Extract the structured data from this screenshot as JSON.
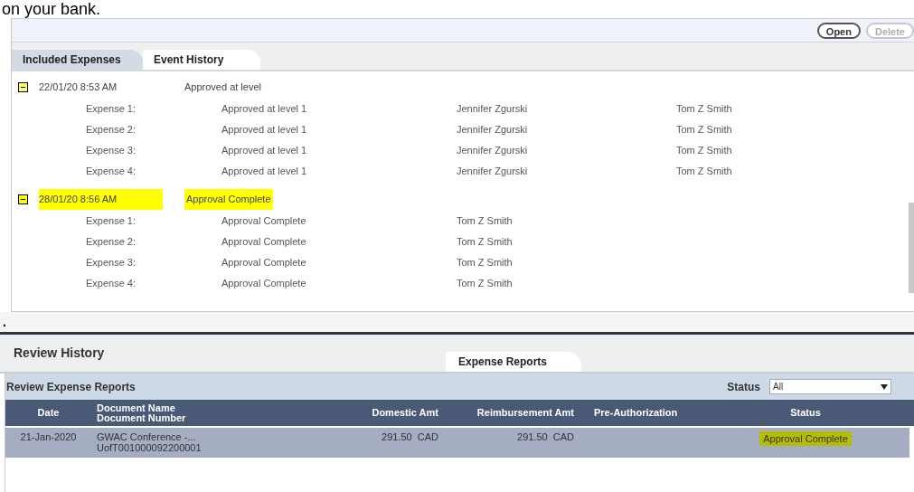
{
  "page_text": "on your bank.",
  "toolbar": {
    "buttons": [
      {
        "label": "Open",
        "disabled": false
      },
      {
        "label": "Delete",
        "disabled": true
      }
    ]
  },
  "tabs": [
    {
      "label": "Included Expenses",
      "selected": false
    },
    {
      "label": "Event History",
      "selected": true
    }
  ],
  "event_groups": [
    {
      "time": "22/01/20 8:53 AM",
      "event": "Approved at level",
      "expanded": true,
      "highlighted": false,
      "children": [
        {
          "item": "Expense 1:",
          "status": "Approved at level 1",
          "approver": "Jennifer Zgurski",
          "submitter": "Tom Z Smith"
        },
        {
          "item": "Expense 2:",
          "status": "Approved at level 1",
          "approver": "Jennifer Zgurski",
          "submitter": "Tom Z Smith"
        },
        {
          "item": "Expense 3:",
          "status": "Approved at level 1",
          "approver": "Jennifer Zgurski",
          "submitter": "Tom Z Smith"
        },
        {
          "item": "Expense 4:",
          "status": "Approved at level 1",
          "approver": "Jennifer Zgurski",
          "submitter": "Tom Z Smith"
        }
      ]
    },
    {
      "time": "28/01/20 8:56 AM",
      "event": "Approval Complete",
      "expanded": true,
      "highlighted": true,
      "children": [
        {
          "item": "Expense 1:",
          "status": "Approval Complete",
          "approver": "Tom Z Smith"
        },
        {
          "item": "Expense 2:",
          "status": "Approval Complete",
          "approver": "Tom Z Smith"
        },
        {
          "item": "Expense 3:",
          "status": "Approval Complete",
          "approver": "Tom Z Smith"
        },
        {
          "item": "Expense 4:",
          "status": "Approval Complete",
          "approver": "Tom Z Smith"
        }
      ]
    }
  ],
  "stray_mark": ".",
  "review": {
    "title": "Review History",
    "tabs": [
      {
        "label": "Expense Reports",
        "selected": true
      }
    ],
    "subtitle": "Review Expense Reports",
    "filter": {
      "label": "Status",
      "value": "All"
    },
    "columns": [
      {
        "lines": [
          "Date"
        ]
      },
      {
        "lines": [
          "Document Name",
          "Document Number"
        ]
      },
      {
        "lines": [
          "Domestic Amt"
        ]
      },
      {
        "lines": [
          "Reimbursement Amt"
        ]
      },
      {
        "lines": [
          "Pre-Authorization"
        ]
      },
      {
        "lines": [
          "Status"
        ]
      }
    ],
    "rows": [
      {
        "date": "21-Jan-2020",
        "document_name": "GWAC Conference -...",
        "document_number": "UofT001000092200001",
        "domestic_amt": "291.50  CAD",
        "reimbursement_amt": "291.50  CAD",
        "status": "Approval Complete",
        "status_highlighted": true
      }
    ]
  }
}
